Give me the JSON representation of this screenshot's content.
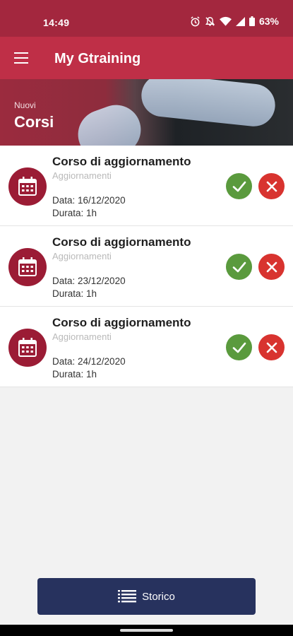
{
  "status_bar": {
    "time": "14:49",
    "battery": "63%"
  },
  "app_bar": {
    "title": "My Gtraining"
  },
  "banner": {
    "subtitle": "Nuovi",
    "title": "Corsi"
  },
  "courses": [
    {
      "title": "Corso di aggiornamento",
      "category": "Aggiornamenti",
      "date": "Data: 16/12/2020",
      "duration": "Durata: 1h"
    },
    {
      "title": "Corso di aggiornamento",
      "category": "Aggiornamenti",
      "date": "Data: 23/12/2020",
      "duration": "Durata: 1h"
    },
    {
      "title": "Corso di aggiornamento",
      "category": "Aggiornamenti",
      "date": "Data: 24/12/2020",
      "duration": "Durata: 1h"
    }
  ],
  "footer": {
    "storico_label": "Storico"
  },
  "colors": {
    "primary": "#bf2f47",
    "status_bar": "#a3273e",
    "accept": "#5a9a3d",
    "decline": "#d8332f",
    "storico": "#27325e"
  }
}
